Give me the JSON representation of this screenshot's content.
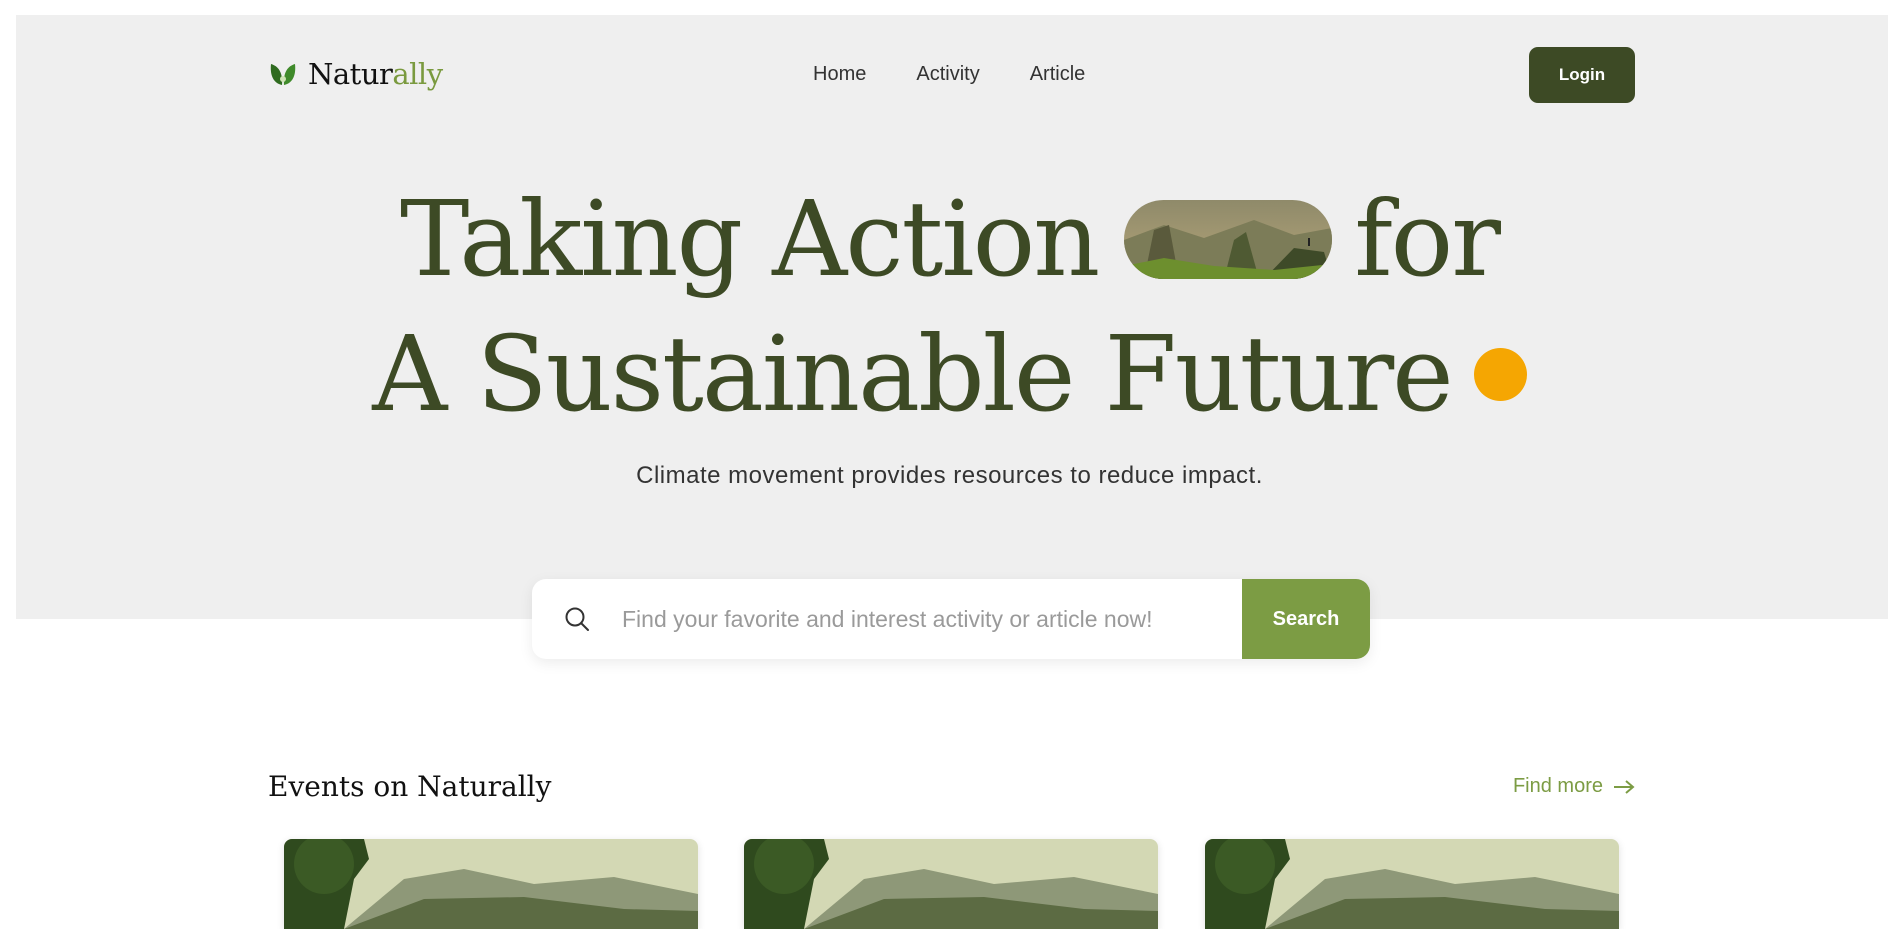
{
  "brand": {
    "name_main": "Natur",
    "name_accent": "ally",
    "logo_icon": "leaf-logo-icon"
  },
  "nav": {
    "items": [
      {
        "label": "Home"
      },
      {
        "label": "Activity"
      },
      {
        "label": "Article"
      }
    ],
    "login_label": "Login"
  },
  "hero": {
    "title_line1_part1": "Taking Action",
    "title_line1_part2": "for",
    "title_line2": "A Sustainable Future",
    "subtitle": "Climate movement provides resources to reduce impact."
  },
  "search": {
    "placeholder": "Find your favorite and interest activity or article now!",
    "button_label": "Search",
    "icon": "search-icon"
  },
  "events": {
    "title": "Events on Naturally",
    "find_more_label": "Find more",
    "cards": [
      {
        "image": "landscape-image"
      },
      {
        "image": "landscape-image"
      },
      {
        "image": "landscape-image"
      }
    ]
  },
  "colors": {
    "primary_dark": "#3d4a25",
    "accent_green": "#7c9c44",
    "accent_orange": "#f5a602",
    "hero_bg": "#efefef"
  }
}
